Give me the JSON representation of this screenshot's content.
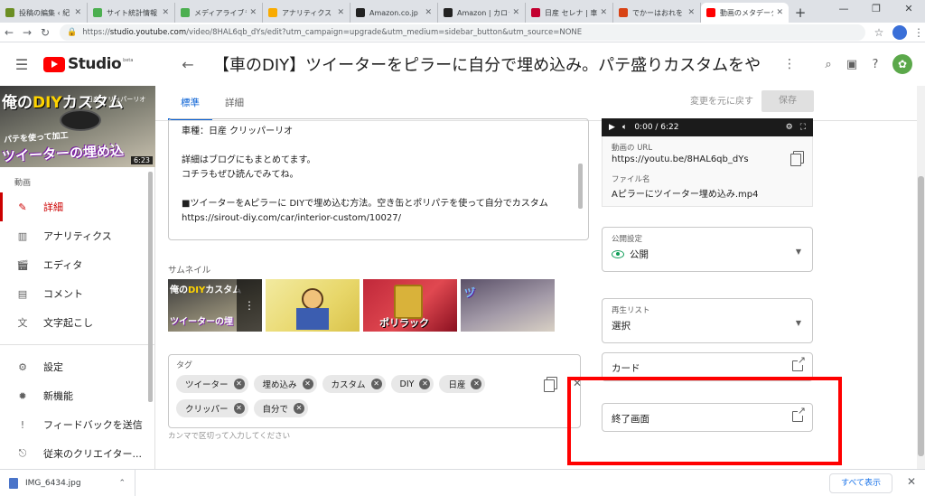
{
  "browser": {
    "tabs": [
      {
        "label": "投稿の編集 ‹ 紀",
        "color": "#6b8e23",
        "active": false
      },
      {
        "label": "サイト統計情報",
        "color": "#4caf50",
        "active": false
      },
      {
        "label": "メディアライブラリ",
        "color": "#4caf50",
        "active": false
      },
      {
        "label": "アナリティクス",
        "color": "#f9ab00",
        "active": false
      },
      {
        "label": "Amazon.co.jp",
        "color": "#222222",
        "active": false
      },
      {
        "label": "Amazon | カロッ",
        "color": "#222222",
        "active": false
      },
      {
        "label": "日産 セレナ | 車",
        "color": "#c3002f",
        "active": false
      },
      {
        "label": "でかーはおれを",
        "color": "#d84315",
        "active": false
      },
      {
        "label": "動画のメタデータ",
        "color": "#ff0000",
        "active": true
      }
    ],
    "url_host": "studio.youtube.com",
    "url_path": "/video/8HAL6qb_dYs/edit?utm_campaign=upgrade&utm_medium=sidebar_button&utm_source=NONE",
    "url_scheme": "https://"
  },
  "header": {
    "logo_text": "Studio",
    "logo_beta": "beta",
    "video_title": "【車のDIY】ツイーターをピラーに自分で埋め込み。パテ盛りカスタムをやって…"
  },
  "sidebar": {
    "thumb": {
      "line1_a": "俺の",
      "line1_b": "DIY",
      "line1_c": "カスタム",
      "brand": "日産 クリッパーリオ",
      "line2": "パテを使って加工",
      "line3": "ツイーターの埋め込",
      "duration": "6:23"
    },
    "section_label": "動画",
    "items": [
      {
        "label": "詳細",
        "icon": "pencil-icon",
        "active": true
      },
      {
        "label": "アナリティクス",
        "icon": "analytics-icon",
        "active": false
      },
      {
        "label": "エディタ",
        "icon": "film-icon",
        "active": false
      },
      {
        "label": "コメント",
        "icon": "comment-icon",
        "active": false
      },
      {
        "label": "文字起こし",
        "icon": "translate-icon",
        "active": false
      }
    ],
    "items2": [
      {
        "label": "設定",
        "icon": "gear-icon"
      },
      {
        "label": "新機能",
        "icon": "whats-new-icon"
      },
      {
        "label": "フィードバックを送信",
        "icon": "feedback-icon"
      },
      {
        "label": "従来のクリエイター...",
        "icon": "classic-studio-icon"
      }
    ]
  },
  "main": {
    "tabs": [
      {
        "label": "標準",
        "active": true
      },
      {
        "label": "詳細",
        "active": false
      }
    ],
    "revert_label": "変更を元に戻す",
    "save_label": "保存",
    "description_lines": [
      "車種：日産 クリッパーリオ",
      "",
      "詳細はブログにもまとめてます。",
      "コチラもぜひ読んでみてね。",
      "",
      "■ツイーターをAピラーに DIYで埋め込む方法。空き缶とポリパテを使って自分でカスタム",
      "https://sirout-diy.com/car/interior-custom/10027/"
    ],
    "thumbnail_label": "サムネイル",
    "thumbs": [
      {
        "t1a": "俺の",
        "t1b": "DIY",
        "t1c": "カスタム",
        "t2": "ツイーターの埋"
      },
      {},
      {
        "txt": "ポリラック"
      },
      {
        "txt": "ヅ"
      }
    ],
    "tags_label": "タグ",
    "tags": [
      "ツイーター",
      "埋め込み",
      "カスタム",
      "DIY",
      "日産",
      "クリッパー",
      "自分で"
    ],
    "tags_hint": "カンマで区切って入力してください"
  },
  "right": {
    "player_time": "0:00 / 6:22",
    "video_url_label": "動画の URL",
    "video_url": "https://youtu.be/8HAL6qb_dYs",
    "filename_label": "ファイル名",
    "filename": "Aピラーにツイーター埋め込み.mp4",
    "visibility_label": "公開設定",
    "visibility_value": "公開",
    "playlist_label": "再生リスト",
    "playlist_value": "選択",
    "cards_label": "カード",
    "endscreen_label": "終了画面"
  },
  "downloads": {
    "file": "IMG_6434.jpg",
    "show_all": "すべて表示"
  },
  "colors": {
    "accent_blue": "#065fd4",
    "active_red": "#cc0000",
    "highlight_red": "#ff0000"
  }
}
